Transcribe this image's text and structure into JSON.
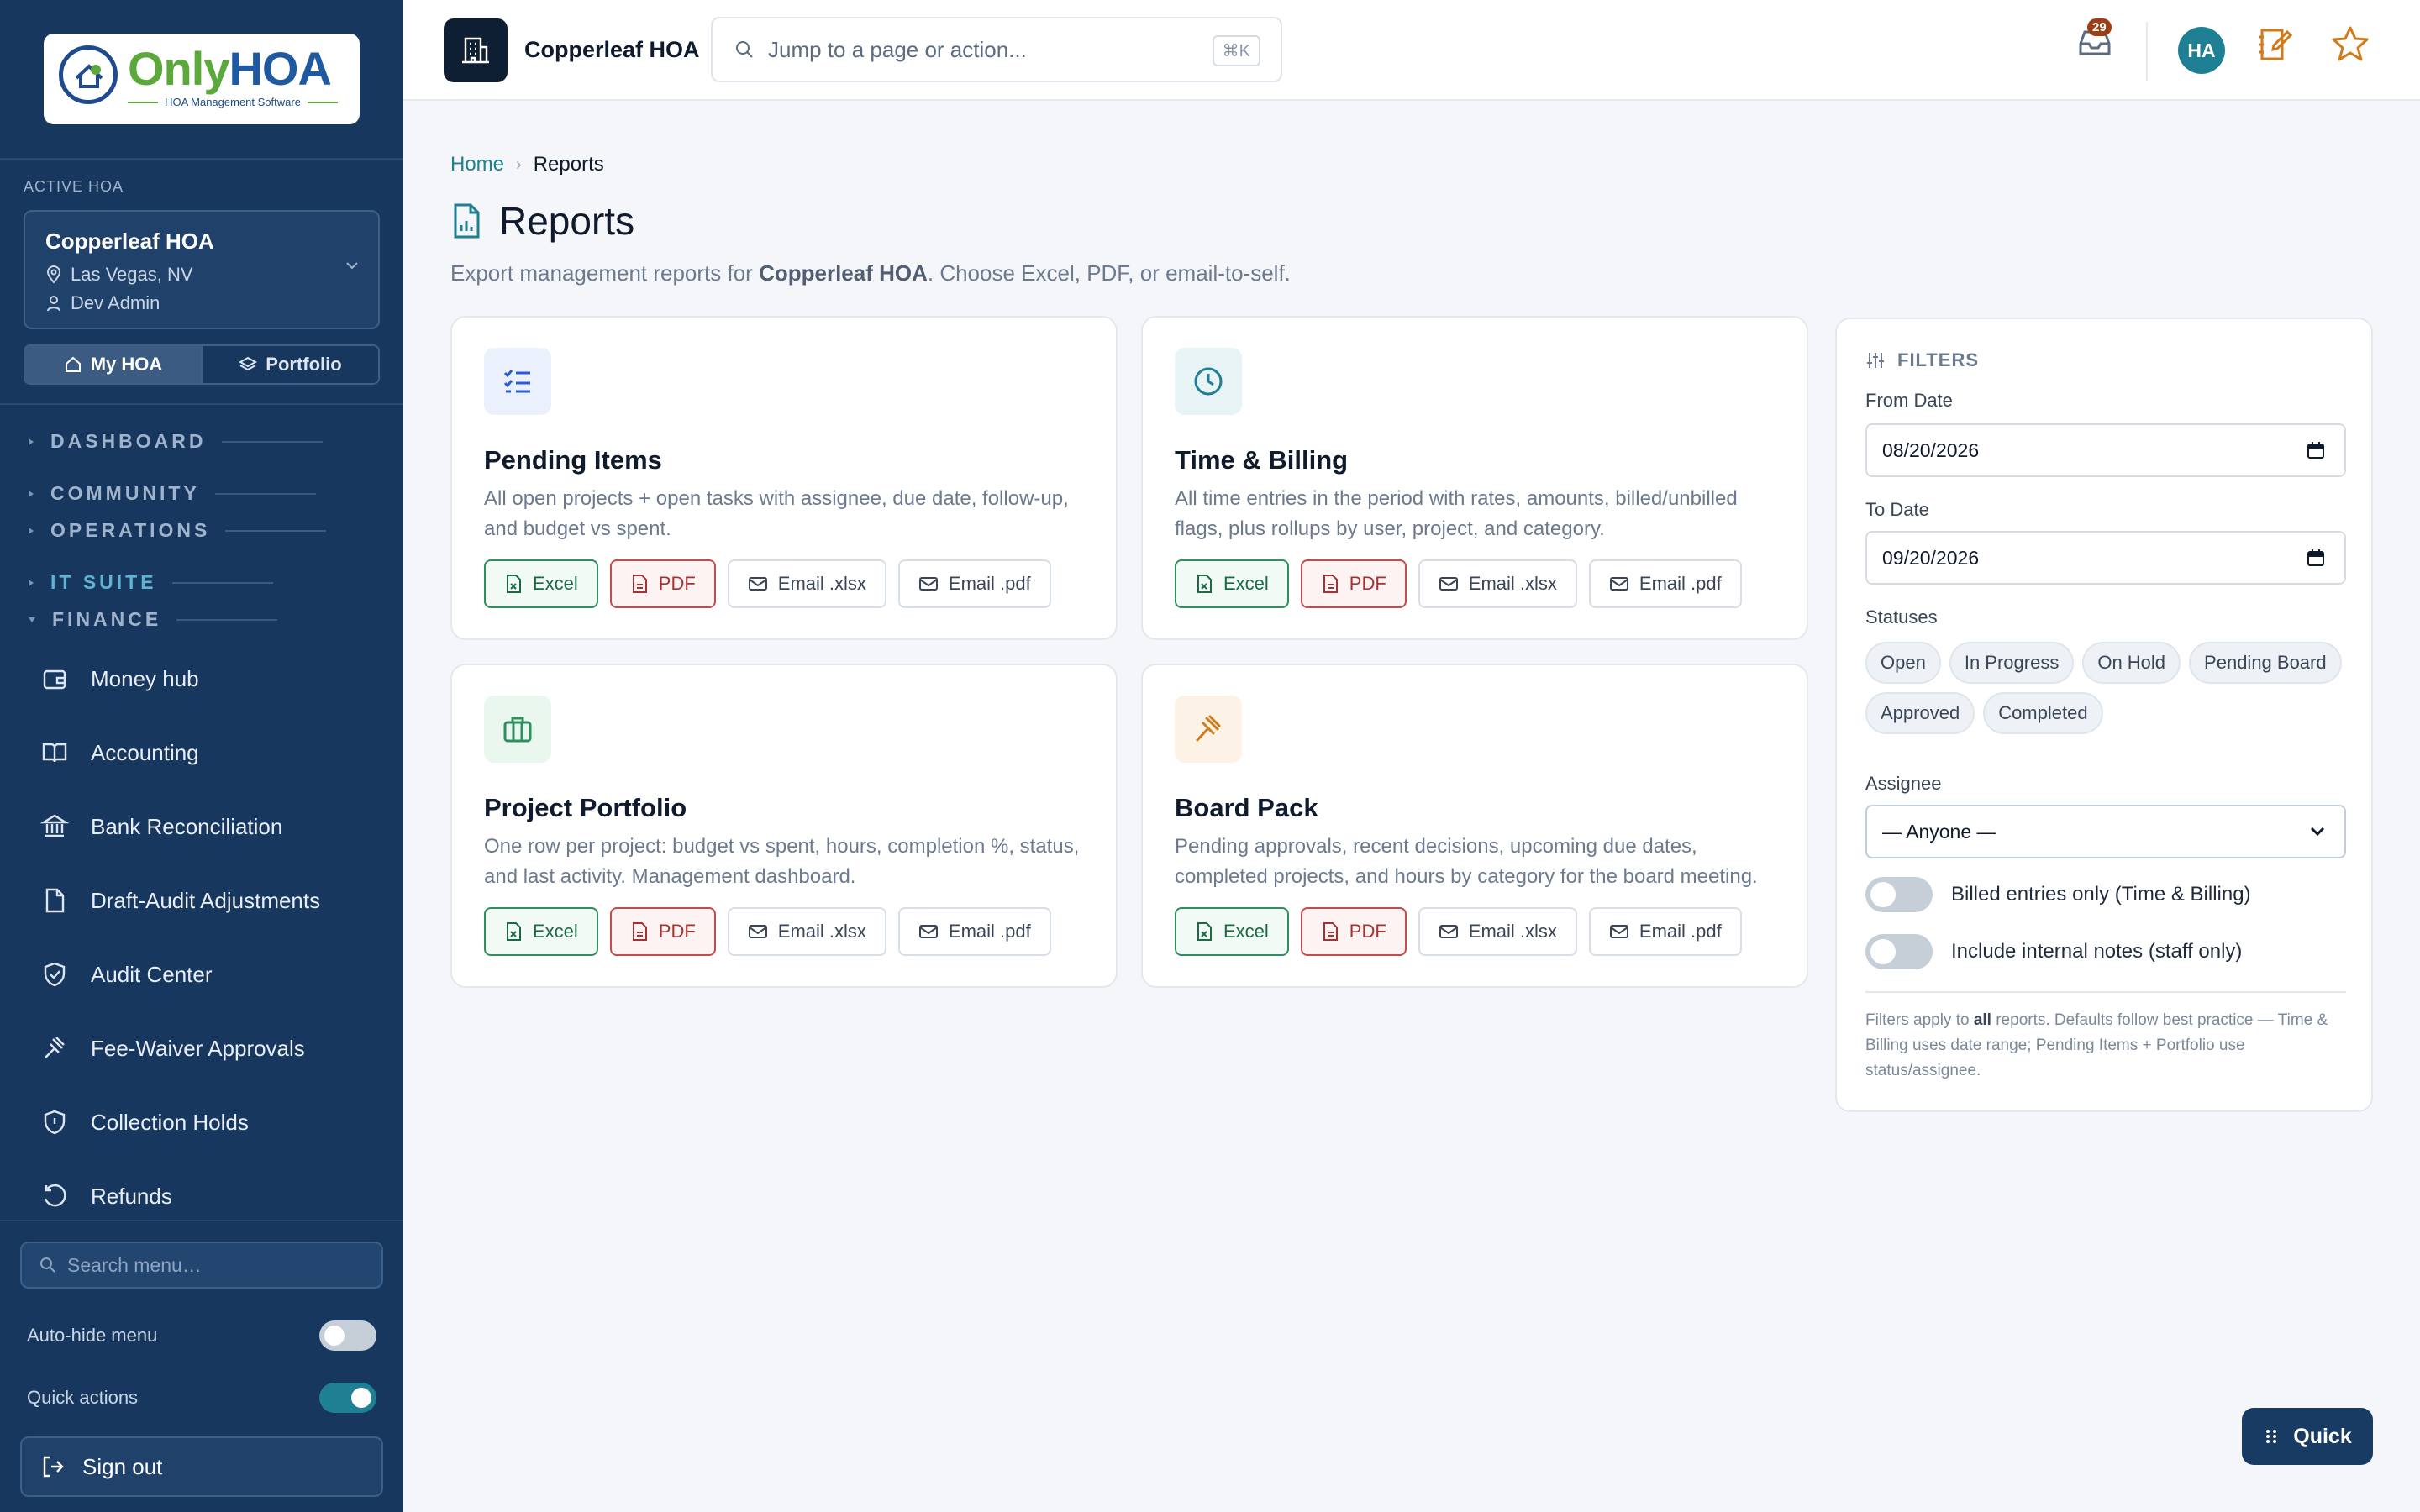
{
  "brand": {
    "logo_only": "Only",
    "logo_hoa": "HOA",
    "logo_sub": "HOA Management Software"
  },
  "sidebar": {
    "active_label": "ACTIVE HOA",
    "hoa_name": "Copperleaf HOA",
    "hoa_location": "Las Vegas, NV",
    "hoa_user": "Dev Admin",
    "tabs": [
      "My HOA",
      "Portfolio"
    ],
    "sections": [
      "DASHBOARD",
      "COMMUNITY",
      "OPERATIONS",
      "IT SUITE",
      "FINANCE"
    ],
    "items": [
      {
        "label": "Money hub",
        "icon": "wallet-icon"
      },
      {
        "label": "Accounting",
        "icon": "book-icon"
      },
      {
        "label": "Bank Reconciliation",
        "icon": "bank-icon"
      },
      {
        "label": "Draft-Audit Adjustments",
        "icon": "file-edit-icon"
      },
      {
        "label": "Audit Center",
        "icon": "shield-check-icon"
      },
      {
        "label": "Fee-Waiver Approvals",
        "icon": "gavel-icon"
      },
      {
        "label": "Collection Holds",
        "icon": "shield-icon"
      },
      {
        "label": "Refunds",
        "icon": "refund-icon"
      }
    ],
    "search_placeholder": "Search menu…",
    "auto_hide_label": "Auto-hide menu",
    "auto_hide_on": false,
    "quick_actions_label": "Quick actions",
    "quick_actions_on": true,
    "sign_out": "Sign out"
  },
  "header": {
    "org_name": "Copperleaf HOA",
    "search_placeholder": "Jump to a page or action...",
    "shortcut": "⌘K",
    "notif_count": "29",
    "avatar_initials": "HA"
  },
  "breadcrumb": {
    "home": "Home",
    "current": "Reports"
  },
  "page": {
    "title": "Reports",
    "subtitle_pre": "Export management reports for ",
    "subtitle_org": "Copperleaf HOA",
    "subtitle_post": ". Choose Excel, PDF, or email-to-self."
  },
  "reports": [
    {
      "title": "Pending Items",
      "desc": "All open projects + open tasks with assignee, due date, follow-up, and budget vs spent.",
      "icon": "checklist-icon",
      "color": "#2b5bd7"
    },
    {
      "title": "Time & Billing",
      "desc": "All time entries in the period with rates, amounts, billed/unbilled flags, plus rollups by user, project, and category.",
      "icon": "clock-icon",
      "color": "#1f7f93"
    },
    {
      "title": "Project Portfolio",
      "desc": "One row per project: budget vs spent, hours, completion %, status, and last activity. Management dashboard.",
      "icon": "briefcase-icon",
      "color": "#2f8f5f"
    },
    {
      "title": "Board Pack",
      "desc": "Pending approvals, recent decisions, upcoming due dates, completed projects, and hours by category for the board meeting.",
      "icon": "gavel-icon",
      "color": "#d07a1a"
    }
  ],
  "actions": {
    "excel": "Excel",
    "pdf": "PDF",
    "email_xlsx": "Email .xlsx",
    "email_pdf": "Email .pdf"
  },
  "filters": {
    "heading": "FILTERS",
    "from_label": "From Date",
    "from_value": "08/20/2026",
    "to_label": "To Date",
    "to_value": "09/20/2026",
    "statuses_label": "Statuses",
    "statuses": [
      "Open",
      "In Progress",
      "On Hold",
      "Pending Board",
      "Approved",
      "Completed"
    ],
    "assignee_label": "Assignee",
    "assignee_value": "— Anyone —",
    "billed_only": "Billed entries only (Time & Billing)",
    "internal_notes": "Include internal notes (staff only)",
    "note_pre": "Filters apply to ",
    "note_bold": "all",
    "note_post": " reports. Defaults follow best practice — Time & Billing uses date range; Pending Items + Portfolio use status/assignee."
  },
  "quick_button": "Quick",
  "colors": {
    "sidebar": "#17375f",
    "accent": "#1f7f93",
    "excel": "#2f8f5f",
    "pdf": "#c64c4c",
    "star": "#d07a1a"
  }
}
